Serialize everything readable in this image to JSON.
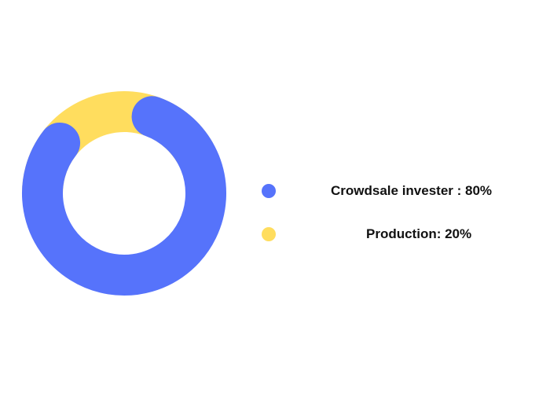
{
  "chart_data": {
    "type": "pie",
    "style": "donut",
    "legend": "right",
    "slices": [
      {
        "label": "Crowdsale invester : 80%",
        "value": 80,
        "color": "#5673fb"
      },
      {
        "label": "Production: 20%",
        "value": 20,
        "color": "#ffdd5e"
      }
    ]
  }
}
